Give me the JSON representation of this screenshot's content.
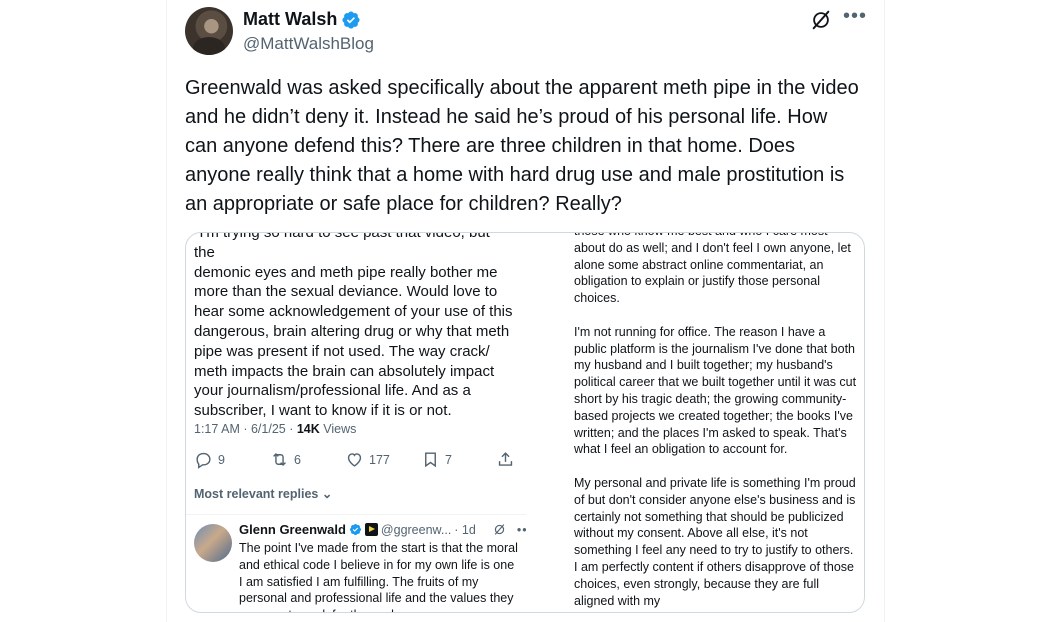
{
  "author": {
    "name": "Matt Walsh",
    "handle": "@MattWalshBlog"
  },
  "tweet": {
    "text": "Greenwald was asked specifically about the apparent meth pipe in the video and he didn’t deny it. Instead he said he’s proud of his personal life. How can anyone defend this? There are three children in that home. Does anyone really think that a home with hard drug use and male prostitution is an appropriate or safe place for children? Really?"
  },
  "screenshot_left": {
    "text_top_partial": "\"I'm trying so hard to see past that video, but the",
    "body": "demonic eyes and meth pipe really bother me more than the sexual deviance. Would love to hear some acknowledgement of your use of this dangerous, brain altering drug or why that meth pipe was present if not used. The way crack/ meth impacts the brain can absolutely impact your journalism/professional life. And as a subscriber, I want to know if it is or not.",
    "meta_time": "1:17 AM · 6/1/25 · ",
    "meta_views_count": "14K",
    "meta_views_label": " Views",
    "actions": {
      "replies": "9",
      "reposts": "6",
      "likes": "177",
      "bookmarks": "7"
    },
    "most_relevant": "Most relevant replies",
    "reply": {
      "name": "Glenn Greenwald",
      "handle": "@ggreenw...",
      "time": "· 1d",
      "text": "The point I've made from the start is that the moral and ethical code I believe in for my own life is one I am satisfied I am fulfilling. The fruits of my personal and professional life and the values they represent speak for themselves."
    }
  },
  "screenshot_right": {
    "paragraphs": [
      "those who know me best and who I care most about do as well; and I don't feel I own anyone, let alone some abstract online commentariat, an obligation to explain or justify those personal choices.",
      "I'm not running for office. The reason I have a public platform is the journalism I've done that both my husband and I built together; my husband's political career that we built together until it was cut short by his tragic death; the growing community-based projects we created together; the books I've written; and the places I'm asked to speak. That's what I feel an obligation to account for.",
      "My personal and private life is something I'm proud of but don't consider anyone else's business and is certainly not something that should be publicized without my consent. Above all else, it's not something I feel any need to try to justify to others. I am perfectly content if others disapprove of those choices, even strongly, because they are full aligned with my"
    ]
  },
  "colors": {
    "text": "#0f1419",
    "secondary": "#536471",
    "verified": "#1d9bf0",
    "border": "#cfd9de"
  }
}
